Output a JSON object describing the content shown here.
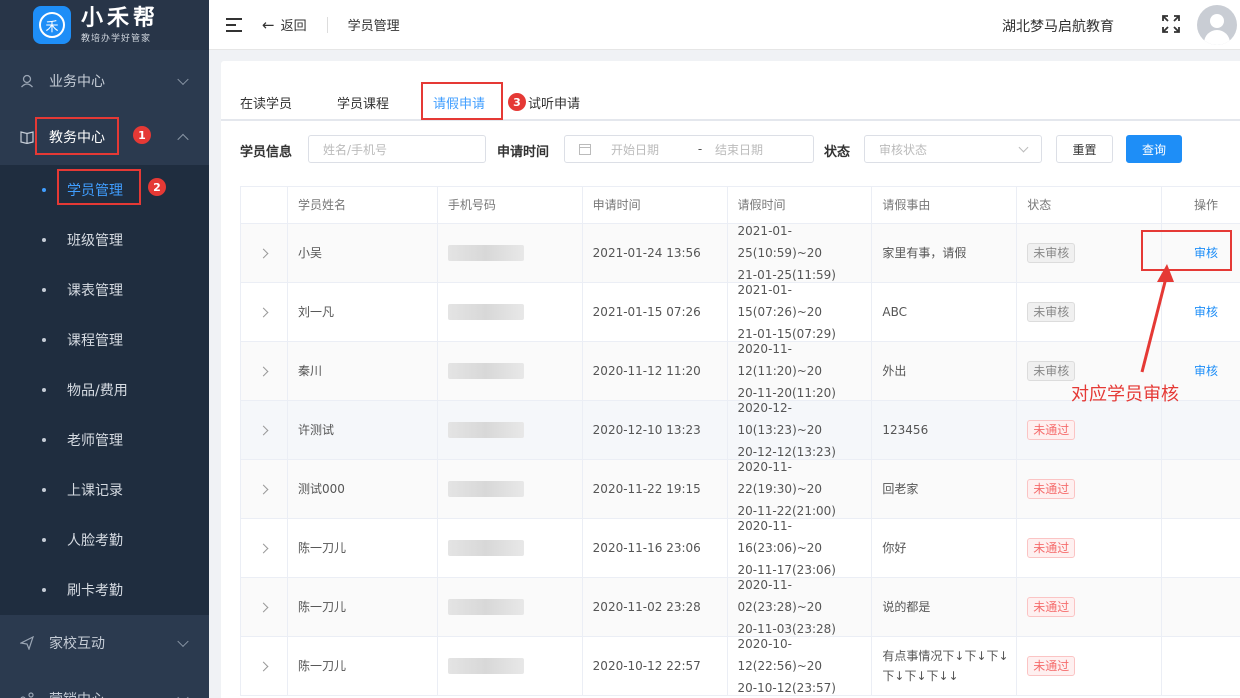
{
  "logo": {
    "icon": "禾",
    "title": "小禾帮",
    "subtitle": "教培办学好管家"
  },
  "sidebar": {
    "groups": [
      {
        "label": "业务中心",
        "icon": "business-icon"
      },
      {
        "label": "教务中心",
        "icon": "book-icon"
      }
    ],
    "sub_items": [
      "学员管理",
      "班级管理",
      "课表管理",
      "课程管理",
      "物品/费用",
      "老师管理",
      "上课记录",
      "人脸考勤",
      "刷卡考勤"
    ],
    "after_groups": [
      {
        "label": "家校互动",
        "icon": "send-icon"
      },
      {
        "label": "营销中心",
        "icon": "share-icon"
      }
    ]
  },
  "annotations": {
    "badge1": "1",
    "badge2": "2",
    "badge3": "3",
    "note": "对应学员审核"
  },
  "header": {
    "back_label": "返回",
    "breadcrumb": "学员管理",
    "org_name": "湖北梦马启航教育"
  },
  "tabs": [
    "在读学员",
    "学员课程",
    "请假申请",
    "试听申请"
  ],
  "filters": {
    "student_label": "学员信息",
    "student_placeholder": "姓名/手机号",
    "apply_time_label": "申请时间",
    "start_placeholder": "开始日期",
    "date_sep": "-",
    "end_placeholder": "结束日期",
    "status_label": "状态",
    "status_placeholder": "审核状态",
    "reset": "重置",
    "query": "查询"
  },
  "table": {
    "headers": [
      "学员姓名",
      "手机号码",
      "申请时间",
      "请假时间",
      "请假事由",
      "状态",
      "操作"
    ],
    "rows": [
      {
        "name": "小吴",
        "apply": "2021-01-24 13:56",
        "leave1": "2021-01-25(10:59)~20",
        "leave2": "21-01-25(11:59)",
        "reason1": "家里有事，请假",
        "reason2": "",
        "status": "未审核",
        "action": "审核"
      },
      {
        "name": "刘一凡",
        "apply": "2021-01-15 07:26",
        "leave1": "2021-01-15(07:26)~20",
        "leave2": "21-01-15(07:29)",
        "reason1": "ABC",
        "reason2": "",
        "status": "未审核",
        "action": "审核"
      },
      {
        "name": "秦川",
        "apply": "2020-11-12 11:20",
        "leave1": "2020-11-12(11:20)~20",
        "leave2": "20-11-20(11:20)",
        "reason1": "外出",
        "reason2": "",
        "status": "未审核",
        "action": "审核"
      },
      {
        "name": "许测试",
        "apply": "2020-12-10 13:23",
        "leave1": "2020-12-10(13:23)~20",
        "leave2": "20-12-12(13:23)",
        "reason1": "123456",
        "reason2": "",
        "status": "未通过",
        "action": ""
      },
      {
        "name": "测试000",
        "apply": "2020-11-22 19:15",
        "leave1": "2020-11-22(19:30)~20",
        "leave2": "20-11-22(21:00)",
        "reason1": "回老家",
        "reason2": "",
        "status": "未通过",
        "action": ""
      },
      {
        "name": "陈一刀儿",
        "apply": "2020-11-16 23:06",
        "leave1": "2020-11-16(23:06)~20",
        "leave2": "20-11-17(23:06)",
        "reason1": "你好",
        "reason2": "",
        "status": "未通过",
        "action": ""
      },
      {
        "name": "陈一刀儿",
        "apply": "2020-11-02 23:28",
        "leave1": "2020-11-02(23:28)~20",
        "leave2": "20-11-03(23:28)",
        "reason1": "说的都是",
        "reason2": "",
        "status": "未通过",
        "action": ""
      },
      {
        "name": "陈一刀儿",
        "apply": "2020-10-12 22:57",
        "leave1": "2020-10-12(22:56)~20",
        "leave2": "20-10-12(23:57)",
        "reason1": "有点事情况下↓下↓下↓",
        "reason2": "下↓下↓下↓↓",
        "status": "未通过",
        "action": ""
      }
    ]
  }
}
